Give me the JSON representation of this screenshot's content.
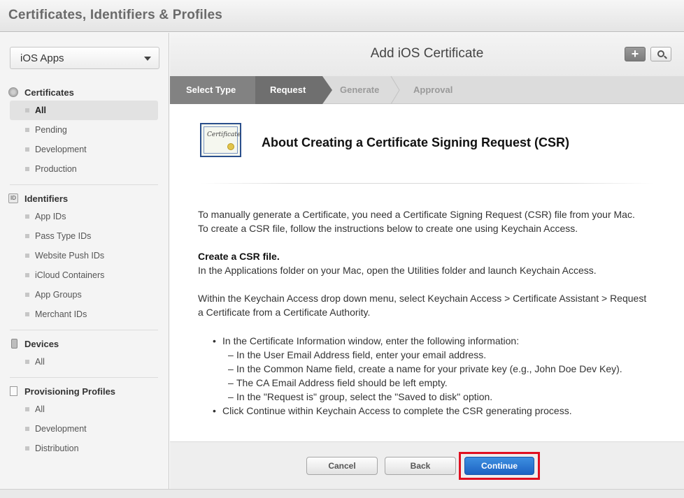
{
  "header": {
    "title": "Certificates, Identifiers & Profiles"
  },
  "sidebar": {
    "platform_select": "iOS Apps",
    "sections": [
      {
        "title": "Certificates",
        "items": [
          "All",
          "Pending",
          "Development",
          "Production"
        ],
        "active_index": 0
      },
      {
        "title": "Identifiers",
        "icon_text": "ID",
        "items": [
          "App IDs",
          "Pass Type IDs",
          "Website Push IDs",
          "iCloud Containers",
          "App Groups",
          "Merchant IDs"
        ]
      },
      {
        "title": "Devices",
        "items": [
          "All"
        ]
      },
      {
        "title": "Provisioning Profiles",
        "items": [
          "All",
          "Development",
          "Distribution"
        ]
      }
    ]
  },
  "main": {
    "title": "Add iOS Certificate",
    "add_button": "+",
    "steps": [
      "Select Type",
      "Request",
      "Generate",
      "Approval"
    ],
    "current_step_index": 1,
    "certificate_icon_text": "Certificate",
    "content": {
      "heading": "About Creating a Certificate Signing Request (CSR)",
      "intro": "To manually generate a Certificate, you need a Certificate Signing Request (CSR) file from your Mac. To create a CSR file, follow the instructions below to create one using Keychain Access.",
      "create_heading": "Create a CSR file.",
      "create_text": "In the Applications folder on your Mac, open the Utilities folder and launch Keychain Access.",
      "menu_text": "Within the Keychain Access drop down menu, select Keychain Access > Certificate Assistant > Request a Certificate from a Certificate Authority.",
      "bullet1": "In the Certificate Information window, enter the following information:",
      "sub_bullets": [
        "In the User Email Address field, enter your email address.",
        "In the Common Name field, create a name for your private key (e.g., John Doe Dev Key).",
        "The CA Email Address field should be left empty.",
        "In the \"Request is\" group, select the \"Saved to disk\" option."
      ],
      "bullet2": "Click Continue within Keychain Access to complete the CSR generating process."
    },
    "footer": {
      "cancel": "Cancel",
      "back": "Back",
      "continue": "Continue"
    }
  },
  "colors": {
    "accent": "#1d63c3",
    "highlight_frame": "#e01020"
  }
}
